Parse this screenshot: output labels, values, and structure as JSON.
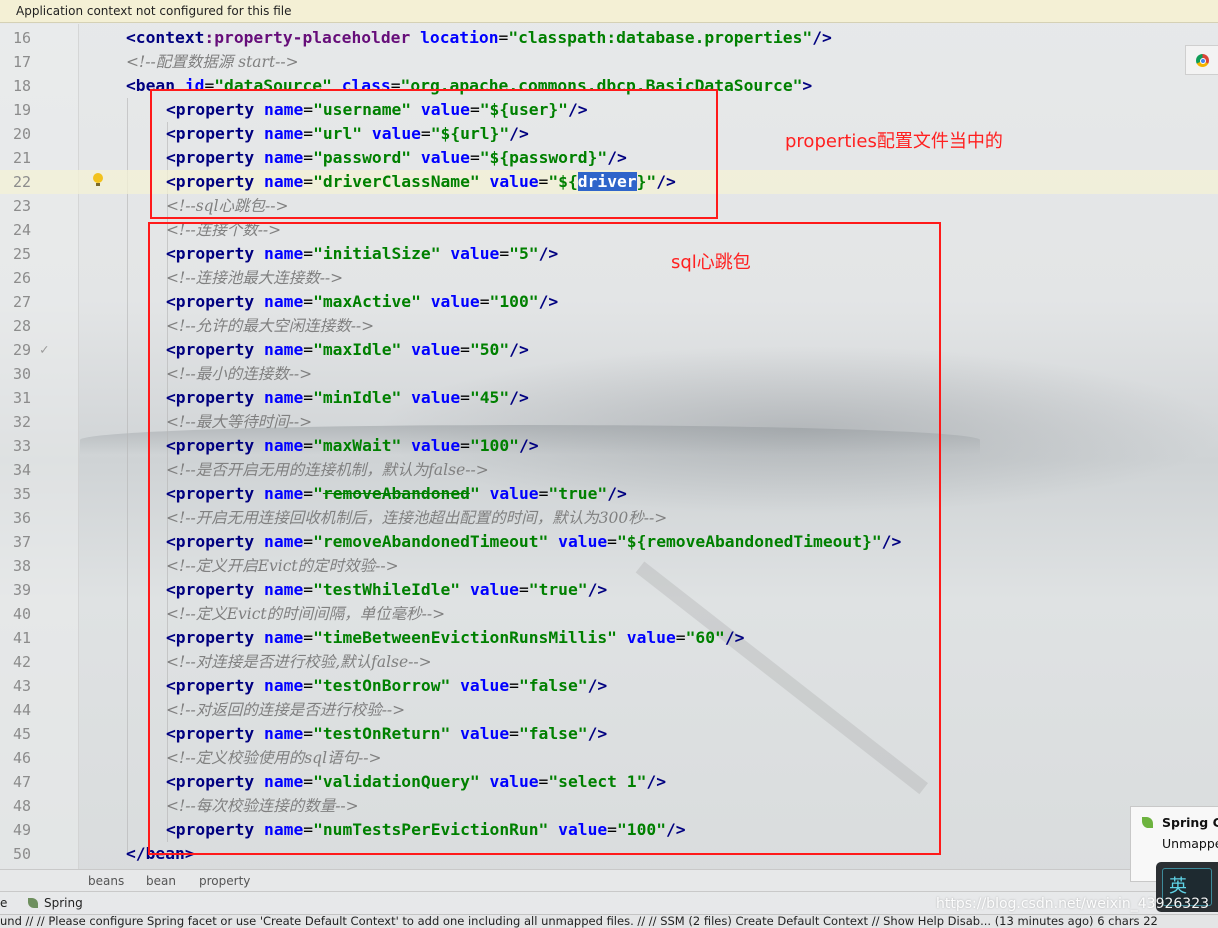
{
  "notice": {
    "text": "Application context not configured for this file"
  },
  "code": {
    "lines": [
      {
        "n": "16",
        "kind": "ctx",
        "tag": "context",
        "ns_sep": ":",
        "tagname": "property-placeholder",
        "attr": "location",
        "value": "\"classpath:database.properties\"",
        "close": "/>"
      },
      {
        "n": "17",
        "kind": "comment",
        "text": "<!--配置数据源 start-->"
      },
      {
        "n": "18",
        "kind": "bean",
        "text_tag": "<bean",
        "a1": "id",
        "v1": "\"dataSource\"",
        "a2": "class",
        "v2": "\"org.apache.commons.dbcp.BasicDataSource\"",
        "close": ">"
      },
      {
        "n": "19",
        "kind": "prop",
        "name": "\"username\"",
        "value": "\"${user}\""
      },
      {
        "n": "20",
        "kind": "prop",
        "name": "\"url\"",
        "value": "\"${url}\""
      },
      {
        "n": "21",
        "kind": "prop",
        "name": "\"password\"",
        "value": "\"${password}\""
      },
      {
        "n": "22",
        "kind": "prop_sel",
        "name": "\"driverClassName\"",
        "value_pre": "\"${",
        "value_sel": "driver",
        "value_post": "}\""
      },
      {
        "n": "23",
        "kind": "comment2",
        "text": "<!--sql心跳包-->"
      },
      {
        "n": "24",
        "kind": "comment2",
        "text": "<!--连接个数-->"
      },
      {
        "n": "25",
        "kind": "prop",
        "name": "\"initialSize\"",
        "value": "\"5\""
      },
      {
        "n": "26",
        "kind": "comment2",
        "text": "<!--连接池最大连接数-->"
      },
      {
        "n": "27",
        "kind": "prop",
        "name": "\"maxActive\"",
        "value": "\"100\""
      },
      {
        "n": "28",
        "kind": "comment2",
        "text": "<!--允许的最大空闲连接数-->"
      },
      {
        "n": "29",
        "kind": "prop",
        "name": "\"maxIdle\"",
        "value": "\"50\""
      },
      {
        "n": "30",
        "kind": "comment2",
        "text": "<!--最小的连接数-->"
      },
      {
        "n": "31",
        "kind": "prop",
        "name": "\"minIdle\"",
        "value": "\"45\""
      },
      {
        "n": "32",
        "kind": "comment2",
        "text": "<!--最大等待时间-->"
      },
      {
        "n": "33",
        "kind": "prop",
        "name": "\"maxWait\"",
        "value": "\"100\""
      },
      {
        "n": "34",
        "kind": "comment2",
        "text": "<!--是否开启无用的连接机制，默认为false-->"
      },
      {
        "n": "35",
        "kind": "prop_strike",
        "name_q1": "\"",
        "name_s": "removeAbandoned",
        "name_q2": "\"",
        "value": "\"true\""
      },
      {
        "n": "36",
        "kind": "comment2",
        "text": "<!--开启无用连接回收机制后，连接池超出配置的时间，默认为300秒-->"
      },
      {
        "n": "37",
        "kind": "prop",
        "name": "\"removeAbandonedTimeout\"",
        "value": "\"${removeAbandonedTimeout}\""
      },
      {
        "n": "38",
        "kind": "comment2",
        "text": "<!--定义开启Evict的定时效验-->"
      },
      {
        "n": "39",
        "kind": "prop",
        "name": "\"testWhileIdle\"",
        "value": "\"true\""
      },
      {
        "n": "40",
        "kind": "comment2",
        "text": "<!--定义Evict的时间间隔，单位毫秒-->"
      },
      {
        "n": "41",
        "kind": "prop",
        "name": "\"timeBetweenEvictionRunsMillis\"",
        "value": "\"60\""
      },
      {
        "n": "42",
        "kind": "comment2",
        "text": "<!--对连接是否进行校验,默认false-->"
      },
      {
        "n": "43",
        "kind": "prop",
        "name": "\"testOnBorrow\"",
        "value": "\"false\""
      },
      {
        "n": "44",
        "kind": "comment2",
        "text": "<!--对返回的连接是否进行校验-->"
      },
      {
        "n": "45",
        "kind": "prop",
        "name": "\"testOnReturn\"",
        "value": "\"false\""
      },
      {
        "n": "46",
        "kind": "comment2",
        "text": "<!--定义校验使用的sql语句-->"
      },
      {
        "n": "47",
        "kind": "prop",
        "name": "\"validationQuery\"",
        "value": "\"select 1\""
      },
      {
        "n": "48",
        "kind": "comment2",
        "text": "<!--每次校验连接的数量-->"
      },
      {
        "n": "49",
        "kind": "prop",
        "name": "\"numTestsPerEvictionRun\"",
        "value": "\"100\""
      },
      {
        "n": "50",
        "kind": "endbean",
        "text": "</bean>"
      }
    ],
    "prop_open": "<property",
    "name_attr": "name",
    "value_attr": "value",
    "eq": "=",
    "self_close": "/>",
    "fold_mark": "✓",
    "fold_line": "29",
    "current_line": "22"
  },
  "annotations": {
    "properties_label": "properties配置文件当中的",
    "sql_label": "sql心跳包"
  },
  "breadcrumb": [
    "beans",
    "bean",
    "property"
  ],
  "tools": {
    "left_cut": "e",
    "spring_tab": "Spring"
  },
  "status": {
    "text": "und  // // Please configure Spring facet or use 'Create Default Context' to add one including all unmapped files. // // SSM (2 files)   Create Default Context // Show Help Disab... (13 minutes ago)     6 chars     22"
  },
  "popup": {
    "title": "Spring Co",
    "subtitle": "Unmappe"
  },
  "ime": {
    "label": "英"
  },
  "watermark": {
    "text": "https://blog.csdn.net/weixin_43926323"
  },
  "colors": {
    "annotation_red": "#ff1a1a",
    "tag": "#000080",
    "attribute": "#0000ff",
    "value": "#008000",
    "comment": "#808080",
    "selection": "#2f65ca"
  }
}
